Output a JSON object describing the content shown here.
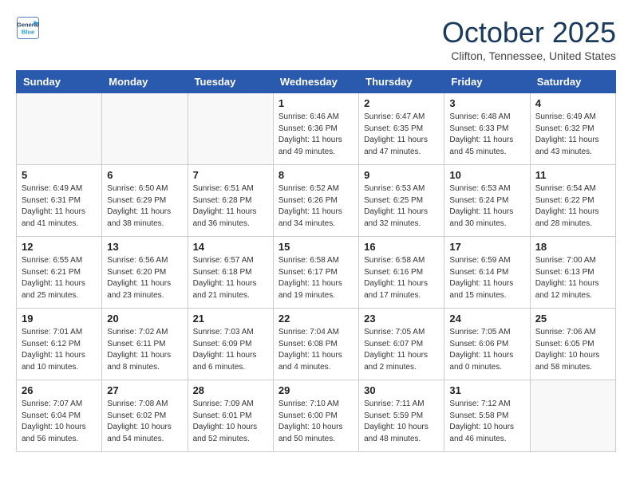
{
  "header": {
    "logo_line1": "General",
    "logo_line2": "Blue",
    "month": "October 2025",
    "location": "Clifton, Tennessee, United States"
  },
  "weekdays": [
    "Sunday",
    "Monday",
    "Tuesday",
    "Wednesday",
    "Thursday",
    "Friday",
    "Saturday"
  ],
  "weeks": [
    [
      {
        "day": "",
        "info": ""
      },
      {
        "day": "",
        "info": ""
      },
      {
        "day": "",
        "info": ""
      },
      {
        "day": "1",
        "info": "Sunrise: 6:46 AM\nSunset: 6:36 PM\nDaylight: 11 hours\nand 49 minutes."
      },
      {
        "day": "2",
        "info": "Sunrise: 6:47 AM\nSunset: 6:35 PM\nDaylight: 11 hours\nand 47 minutes."
      },
      {
        "day": "3",
        "info": "Sunrise: 6:48 AM\nSunset: 6:33 PM\nDaylight: 11 hours\nand 45 minutes."
      },
      {
        "day": "4",
        "info": "Sunrise: 6:49 AM\nSunset: 6:32 PM\nDaylight: 11 hours\nand 43 minutes."
      }
    ],
    [
      {
        "day": "5",
        "info": "Sunrise: 6:49 AM\nSunset: 6:31 PM\nDaylight: 11 hours\nand 41 minutes."
      },
      {
        "day": "6",
        "info": "Sunrise: 6:50 AM\nSunset: 6:29 PM\nDaylight: 11 hours\nand 38 minutes."
      },
      {
        "day": "7",
        "info": "Sunrise: 6:51 AM\nSunset: 6:28 PM\nDaylight: 11 hours\nand 36 minutes."
      },
      {
        "day": "8",
        "info": "Sunrise: 6:52 AM\nSunset: 6:26 PM\nDaylight: 11 hours\nand 34 minutes."
      },
      {
        "day": "9",
        "info": "Sunrise: 6:53 AM\nSunset: 6:25 PM\nDaylight: 11 hours\nand 32 minutes."
      },
      {
        "day": "10",
        "info": "Sunrise: 6:53 AM\nSunset: 6:24 PM\nDaylight: 11 hours\nand 30 minutes."
      },
      {
        "day": "11",
        "info": "Sunrise: 6:54 AM\nSunset: 6:22 PM\nDaylight: 11 hours\nand 28 minutes."
      }
    ],
    [
      {
        "day": "12",
        "info": "Sunrise: 6:55 AM\nSunset: 6:21 PM\nDaylight: 11 hours\nand 25 minutes."
      },
      {
        "day": "13",
        "info": "Sunrise: 6:56 AM\nSunset: 6:20 PM\nDaylight: 11 hours\nand 23 minutes."
      },
      {
        "day": "14",
        "info": "Sunrise: 6:57 AM\nSunset: 6:18 PM\nDaylight: 11 hours\nand 21 minutes."
      },
      {
        "day": "15",
        "info": "Sunrise: 6:58 AM\nSunset: 6:17 PM\nDaylight: 11 hours\nand 19 minutes."
      },
      {
        "day": "16",
        "info": "Sunrise: 6:58 AM\nSunset: 6:16 PM\nDaylight: 11 hours\nand 17 minutes."
      },
      {
        "day": "17",
        "info": "Sunrise: 6:59 AM\nSunset: 6:14 PM\nDaylight: 11 hours\nand 15 minutes."
      },
      {
        "day": "18",
        "info": "Sunrise: 7:00 AM\nSunset: 6:13 PM\nDaylight: 11 hours\nand 12 minutes."
      }
    ],
    [
      {
        "day": "19",
        "info": "Sunrise: 7:01 AM\nSunset: 6:12 PM\nDaylight: 11 hours\nand 10 minutes."
      },
      {
        "day": "20",
        "info": "Sunrise: 7:02 AM\nSunset: 6:11 PM\nDaylight: 11 hours\nand 8 minutes."
      },
      {
        "day": "21",
        "info": "Sunrise: 7:03 AM\nSunset: 6:09 PM\nDaylight: 11 hours\nand 6 minutes."
      },
      {
        "day": "22",
        "info": "Sunrise: 7:04 AM\nSunset: 6:08 PM\nDaylight: 11 hours\nand 4 minutes."
      },
      {
        "day": "23",
        "info": "Sunrise: 7:05 AM\nSunset: 6:07 PM\nDaylight: 11 hours\nand 2 minutes."
      },
      {
        "day": "24",
        "info": "Sunrise: 7:05 AM\nSunset: 6:06 PM\nDaylight: 11 hours\nand 0 minutes."
      },
      {
        "day": "25",
        "info": "Sunrise: 7:06 AM\nSunset: 6:05 PM\nDaylight: 10 hours\nand 58 minutes."
      }
    ],
    [
      {
        "day": "26",
        "info": "Sunrise: 7:07 AM\nSunset: 6:04 PM\nDaylight: 10 hours\nand 56 minutes."
      },
      {
        "day": "27",
        "info": "Sunrise: 7:08 AM\nSunset: 6:02 PM\nDaylight: 10 hours\nand 54 minutes."
      },
      {
        "day": "28",
        "info": "Sunrise: 7:09 AM\nSunset: 6:01 PM\nDaylight: 10 hours\nand 52 minutes."
      },
      {
        "day": "29",
        "info": "Sunrise: 7:10 AM\nSunset: 6:00 PM\nDaylight: 10 hours\nand 50 minutes."
      },
      {
        "day": "30",
        "info": "Sunrise: 7:11 AM\nSunset: 5:59 PM\nDaylight: 10 hours\nand 48 minutes."
      },
      {
        "day": "31",
        "info": "Sunrise: 7:12 AM\nSunset: 5:58 PM\nDaylight: 10 hours\nand 46 minutes."
      },
      {
        "day": "",
        "info": ""
      }
    ]
  ]
}
